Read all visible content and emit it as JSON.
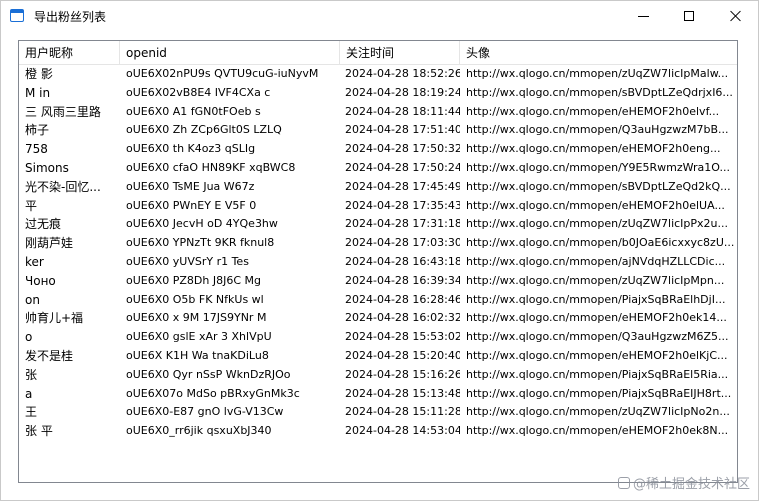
{
  "window": {
    "title": "导出粉丝列表",
    "icon": "window-app-icon",
    "buttons": {
      "minimize": "minimize-icon",
      "maximize": "maximize-icon",
      "close": "close-icon"
    }
  },
  "list": {
    "columns": [
      {
        "label": "用户昵称"
      },
      {
        "label": "openid"
      },
      {
        "label": "关注时间"
      },
      {
        "label": "头像"
      }
    ],
    "rows": [
      {
        "name": "橙 影",
        "openid": "oUE6X02nPU9s QVTU9cuG-iuNyvM",
        "time": "2024-04-28 18:52:26",
        "avatar": "http://wx.qlogo.cn/mmopen/zUqZW7licIpMalw..."
      },
      {
        "name": "M in",
        "openid": "oUE6X02vB8E4 IVF4CXa c",
        "time": "2024-04-28 18:19:24",
        "avatar": "http://wx.qlogo.cn/mmopen/sBVDptLZeQdrjxI6..."
      },
      {
        "name": "三 风雨三里路",
        "openid": "oUE6X0 A1 fGN0tFOeb s",
        "time": "2024-04-28 18:11:44",
        "avatar": "http://wx.qlogo.cn/mmopen/eHEMOF2h0elvf..."
      },
      {
        "name": "柿子",
        "openid": "oUE6X0 Zh ZCp6Glt0S LZLQ",
        "time": "2024-04-28 17:51:40",
        "avatar": "http://wx.qlogo.cn/mmopen/Q3auHgzwzM7bB..."
      },
      {
        "name": "758",
        "openid": "oUE6X0 th K4oz3 qSLIg",
        "time": "2024-04-28 17:50:32",
        "avatar": "http://wx.qlogo.cn/mmopen/eHEMOF2h0eng..."
      },
      {
        "name": "Simons",
        "openid": "oUE6X0 cfaO HN89KF xqBWC8",
        "time": "2024-04-28 17:50:24",
        "avatar": "http://wx.qlogo.cn/mmopen/Y9E5RwmzWra1O..."
      },
      {
        "name": "光不染-回忆...",
        "openid": "oUE6X0 TsME Jua W67z",
        "time": "2024-04-28 17:45:49",
        "avatar": "http://wx.qlogo.cn/mmopen/sBVDptLZeQd2kQ..."
      },
      {
        "name": "平",
        "openid": "oUE6X0 PWnEY E V5F 0",
        "time": "2024-04-28 17:35:43",
        "avatar": "http://wx.qlogo.cn/mmopen/eHEMOF2h0elUA..."
      },
      {
        "name": "过无痕",
        "openid": "oUE6X0 JecvH oD 4YQe3hw",
        "time": "2024-04-28 17:31:18",
        "avatar": "http://wx.qlogo.cn/mmopen/zUqZW7licIpPx2u..."
      },
      {
        "name": "刚葫芦娃",
        "openid": "oUE6X0 YPNzTt 9KR fknul8",
        "time": "2024-04-28 17:03:30",
        "avatar": "http://wx.qlogo.cn/mmopen/b0JOaE6icxxyc8zU..."
      },
      {
        "name": "ker",
        "openid": "oUE6X0 yUVSrY r1 Tes",
        "time": "2024-04-28 16:43:18",
        "avatar": "http://wx.qlogo.cn/mmopen/ajNVdqHZLLCDic..."
      },
      {
        "name": "Чоно",
        "openid": "oUE6X0 PZ8Dh J8J6C Mg",
        "time": "2024-04-28 16:39:34",
        "avatar": "http://wx.qlogo.cn/mmopen/zUqZW7licIpMpn..."
      },
      {
        "name": "on",
        "openid": "oUE6X0 O5b FK NfkUs wl",
        "time": "2024-04-28 16:28:46",
        "avatar": "http://wx.qlogo.cn/mmopen/PiajxSqBRaElhDjI..."
      },
      {
        "name": "帅育儿+福",
        "openid": "oUE6X0 x 9M 17JS9YNr M",
        "time": "2024-04-28 16:02:32",
        "avatar": "http://wx.qlogo.cn/mmopen/eHEMOF2h0ek14..."
      },
      {
        "name": "o",
        "openid": "oUE6X0 gslE xAr 3 XhlVpU",
        "time": "2024-04-28 15:53:02",
        "avatar": "http://wx.qlogo.cn/mmopen/Q3auHgzwzM6Z5..."
      },
      {
        "name": "发不是桂",
        "openid": "oUE6X K1H Wa tnaKDiLu8",
        "time": "2024-04-28 15:20:40",
        "avatar": "http://wx.qlogo.cn/mmopen/eHEMOF2h0elKjC..."
      },
      {
        "name": "张",
        "openid": "oUE6X0 Qyr nSsP WknDzRJOo",
        "time": "2024-04-28 15:16:26",
        "avatar": "http://wx.qlogo.cn/mmopen/PiajxSqBRaEl5Ria..."
      },
      {
        "name": "a",
        "openid": "oUE6X07o MdSo pBRxyGnMk3c",
        "time": "2024-04-28 15:13:48",
        "avatar": "http://wx.qlogo.cn/mmopen/PiajxSqBRaEIJH8rt..."
      },
      {
        "name": "王",
        "openid": "oUE6X0-E87 gnO lvG-V13Cw",
        "time": "2024-04-28 15:11:28",
        "avatar": "http://wx.qlogo.cn/mmopen/zUqZW7licIpNo2n..."
      },
      {
        "name": "张 平",
        "openid": "oUE6X0_rr6jik qsxuXbJ340",
        "time": "2024-04-28 14:53:04",
        "avatar": "http://wx.qlogo.cn/mmopen/eHEMOF2h0ek8N..."
      }
    ]
  },
  "watermark": {
    "text": "@稀土掘金技术社区"
  }
}
